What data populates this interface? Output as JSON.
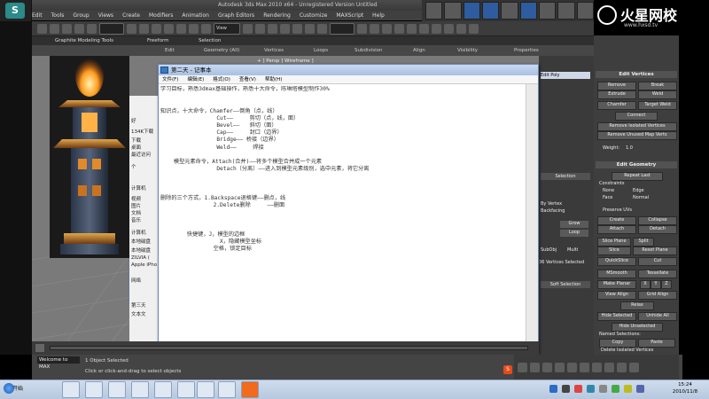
{
  "max": {
    "title": "Autodesk 3ds Max  2010 x64  - Unregistered Version  Untitled",
    "menu": [
      "Edit",
      "Tools",
      "Group",
      "Views",
      "Create",
      "Modifiers",
      "Animation",
      "Graph Editors",
      "Rendering",
      "Customize",
      "MAXScript",
      "Help"
    ],
    "ribbon_tabs": [
      "Graphite Modeling Tools",
      "Freeform",
      "Selection"
    ],
    "ribbon_items": [
      "Edit",
      "Geometry (All)",
      "Vertices",
      "Loops",
      "Subdivision",
      "Align",
      "Visibility",
      "Properties"
    ],
    "viewport_label": "+ ] Persp ] Wireframe ]",
    "status_badge": "Welcome to MAX",
    "status_line1": "1 Object Selected",
    "status_line2": "Click or click-and-drag to select objects",
    "selection_dropdown": "View"
  },
  "quickbar": [
    {
      "label": "",
      "blue": false
    },
    {
      "label": "",
      "blue": false
    },
    {
      "label": "",
      "blue": true
    },
    {
      "label": "",
      "blue": true
    },
    {
      "label": "",
      "blue": false
    },
    {
      "label": "",
      "blue": true
    },
    {
      "label": "",
      "blue": false
    },
    {
      "label": "",
      "blue": false
    },
    {
      "label": "",
      "blue": false
    }
  ],
  "watermark": {
    "title": "火星网校",
    "url": "www.hxsd.tv"
  },
  "right_panel": {
    "edit_vertices_header": "Edit Vertices",
    "edit_vertices_buttons": [
      "Remove",
      "Break",
      "Extrude",
      "Weld",
      "Chamfer",
      "Target Weld",
      "Connect",
      "Remove Isolated Vertices",
      "Remove Unused Map Verts"
    ],
    "weight_label": "Weight:",
    "weight_value": "1.0",
    "edit_geometry_header": "Edit Geometry",
    "repeat_last": "Repeat Last",
    "constraints_label": "Constraints",
    "constraints_options": [
      "None",
      "Edge",
      "Face",
      "Normal"
    ],
    "preserve_uvs": "Preserve UVs",
    "edit_geometry_buttons": [
      "Create",
      "Collapse",
      "Attach",
      "Detach",
      "Slice Plane",
      "Split",
      "Slice",
      "Reset Plane",
      "QuickSlice",
      "Cut",
      "MSmooth",
      "Tessellate",
      "Make Planar",
      "X",
      "Y",
      "Z",
      "View Align",
      "Grid Align",
      "Relax",
      "Hide Selected",
      "Unhide All",
      "Hide Unselected"
    ],
    "named_selections": "Named Selections:",
    "copy": "Copy",
    "paste": "Paste",
    "delete_isolated": "Delete Isolated Vertices"
  },
  "cmd_panel": {
    "selection_header": "Selection",
    "by_vertex": "By Vertex",
    "backfacing": "Backfacing",
    "grow": "Grow",
    "loop": "Loop",
    "subobj": "SubObj",
    "multi": "Multi",
    "vertices_selected": "36 Vertices Selected",
    "soft_selection": "Soft Selection",
    "edit_poly": "Edit Poly"
  },
  "explorer": {
    "items": [
      "好",
      "134K下载",
      "下载",
      "桌面",
      "最近访问",
      "个",
      "计算机",
      "视频",
      "图片",
      "文档",
      "音乐",
      "计算机",
      "本地磁盘",
      "本地磁盘",
      "ZILVIA (",
      "Apple iPho",
      "网络",
      "第三天",
      "文本文"
    ]
  },
  "notepad": {
    "title": "第二天 - 记事本",
    "menu": [
      "文件(F)",
      "编辑(E)",
      "格式(O)",
      "查看(V)",
      "帮助(H)"
    ],
    "lines": [
      "学习目标，熟悉3dmax基础操作，熟悉十大命令，陈琳塔模型制作30%",
      "",
      "",
      "知识点，十大命令，Chamfer——倒角（点，线）",
      "                 Cut——     剪切（点，线，面）",
      "                 Bevel——   斜切（面）",
      "                 Cap——     封口（边界）",
      "                 Bridge—— 桥接（边界）",
      "                 Weld——     焊接",
      "",
      "    模型元素命令，Attach(合并)——将多个模型合并成一个元素",
      "                 Detach（分离）——进入到模型元素级别，选中元素，将它分离",
      "",
      "",
      "",
      "删除的三个方式，1.Backspace退格键——删点，线",
      "                2.Delete删除     ——删面",
      "",
      "",
      "",
      "        快捷键，J，模型的边框",
      "                  X，隐藏模型坐标",
      "                空格，锁定目标"
    ]
  },
  "taskbar": {
    "start": "开始",
    "time": "15:24",
    "date": "2010/11/8"
  }
}
